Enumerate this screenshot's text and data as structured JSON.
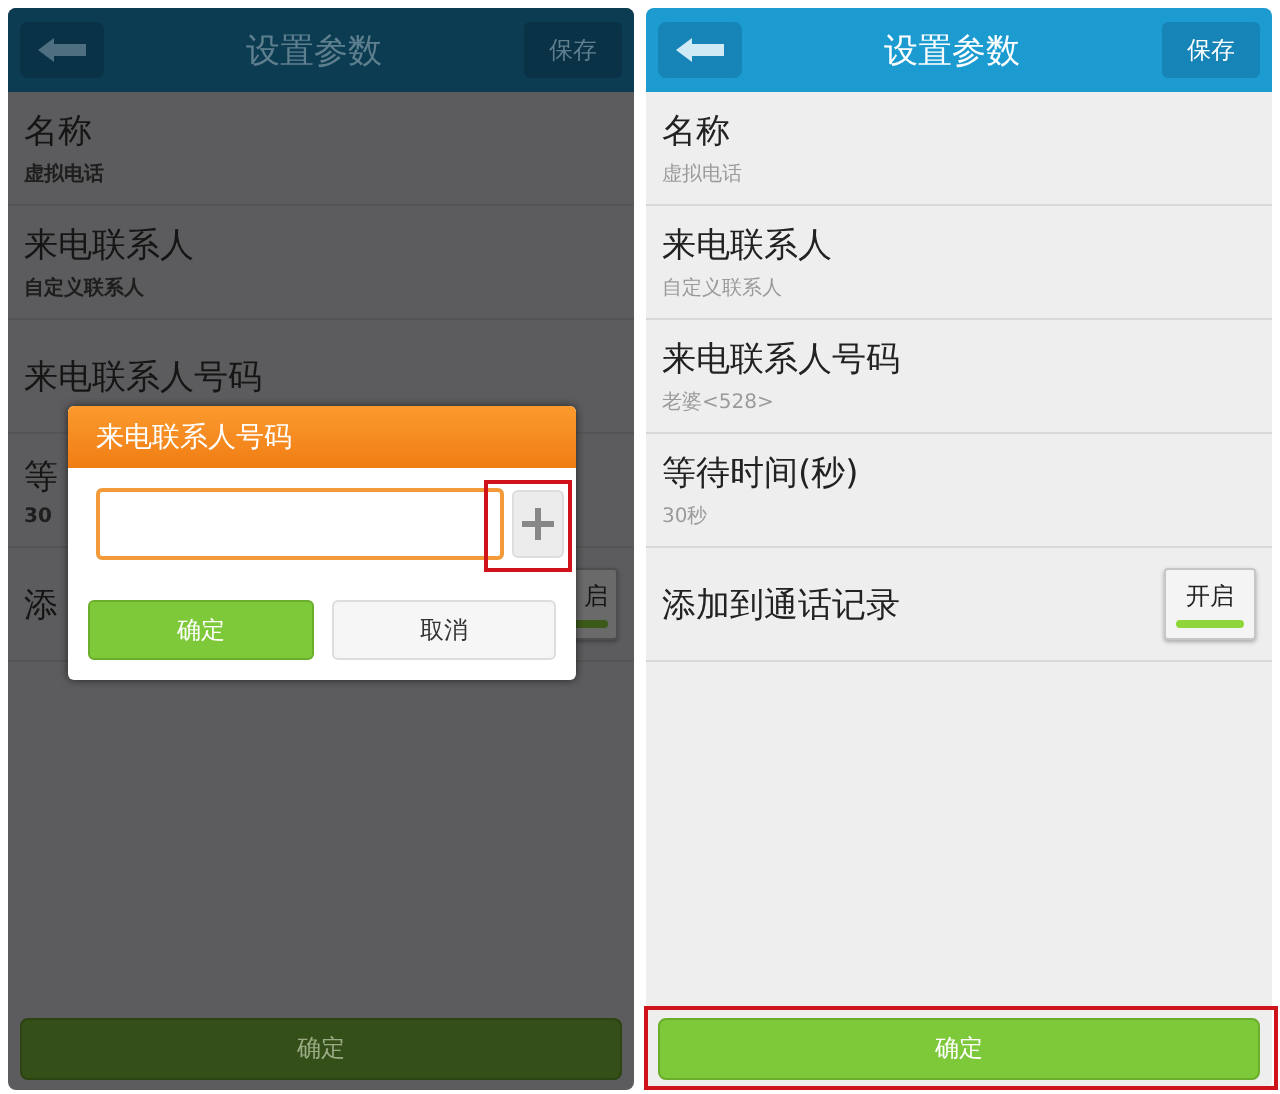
{
  "screens": [
    {
      "dimmed": true,
      "header": {
        "title": "设置参数",
        "action": "保存"
      },
      "rows": [
        {
          "kind": "item",
          "title": "名称",
          "subtitle": "虚拟电话"
        },
        {
          "kind": "item",
          "title": "来电联系人",
          "subtitle": "自定义联系人"
        },
        {
          "kind": "item",
          "title": "来电联系人号码"
        },
        {
          "kind": "item",
          "title": "等",
          "subtitle": "30"
        },
        {
          "kind": "toggle",
          "title": "添",
          "toggle": {
            "label": "启",
            "on": true
          }
        }
      ],
      "confirm": {
        "label": "确定"
      },
      "dialog": {
        "title": "来电联系人号码",
        "add_highlighted": true,
        "buttons": [
          {
            "label": "确定",
            "kind": "primary"
          },
          {
            "label": "取消",
            "kind": "secondary"
          }
        ]
      }
    },
    {
      "dimmed": false,
      "header": {
        "title": "设置参数",
        "action": "保存"
      },
      "rows": [
        {
          "kind": "item",
          "title": "名称",
          "subtitle": "虚拟电话"
        },
        {
          "kind": "item",
          "title": "来电联系人",
          "subtitle": "自定义联系人"
        },
        {
          "kind": "item",
          "title": "来电联系人号码",
          "subtitle": "老婆<528>"
        },
        {
          "kind": "item",
          "title": "等待时间(秒)",
          "subtitle": "30秒"
        },
        {
          "kind": "toggle",
          "title": "添加到通话记录",
          "toggle": {
            "label": "开启",
            "on": true
          }
        }
      ],
      "confirm": {
        "label": "确定",
        "highlighted": true
      }
    }
  ]
}
